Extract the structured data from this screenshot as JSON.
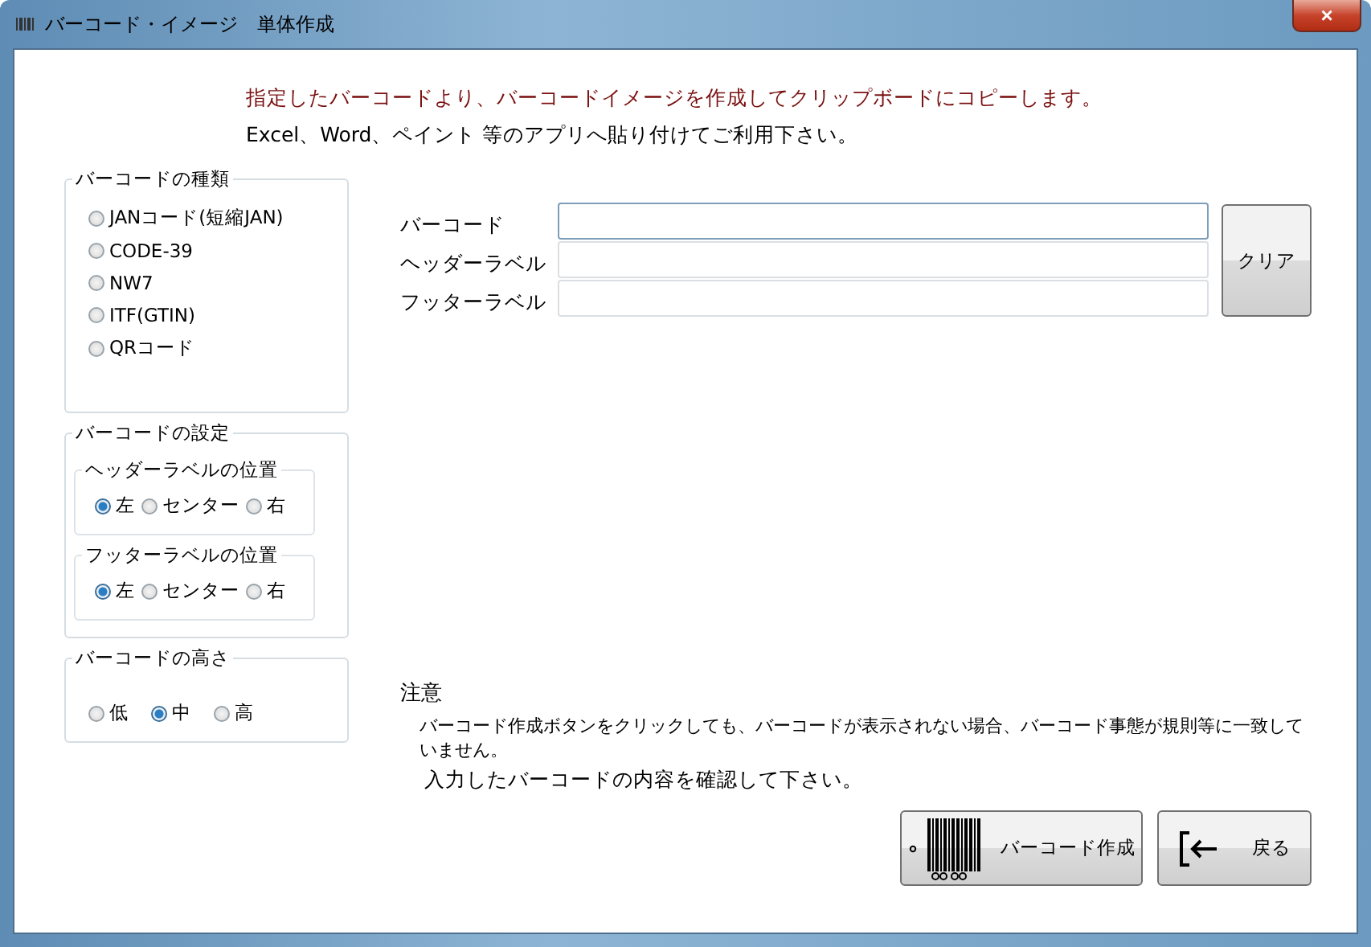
{
  "window": {
    "title": "バーコード・イメージ　単体作成",
    "close": "×"
  },
  "intro": {
    "line_1": "指定したバーコードより、バーコードイメージを作成してクリップボードにコピーします。",
    "line_2": "Excel、Word、ペイント 等のアプリへ貼り付けてご利用下さい。"
  },
  "barcode_type": {
    "title": "バーコードの種類",
    "options": [
      {
        "label": "JANコード(短縮JAN)",
        "selected": false
      },
      {
        "label": "CODE-39",
        "selected": false
      },
      {
        "label": "NW7",
        "selected": false
      },
      {
        "label": "ITF(GTIN)",
        "selected": false
      },
      {
        "label": "QRコード",
        "selected": false
      }
    ]
  },
  "barcode_settings": {
    "title": "バーコードの設定",
    "groups": [
      {
        "title": "ヘッダーラベルの位置",
        "options": [
          {
            "label": "左",
            "selected": true
          },
          {
            "label": "センター",
            "selected": false
          },
          {
            "label": "右",
            "selected": false
          }
        ]
      },
      {
        "title": "フッターラベルの位置",
        "options": [
          {
            "label": "左",
            "selected": true
          },
          {
            "label": "センター",
            "selected": false
          },
          {
            "label": "右",
            "selected": false
          }
        ]
      }
    ]
  },
  "barcode_height": {
    "title": "バーコードの高さ",
    "options": [
      {
        "label": "低",
        "selected": false
      },
      {
        "label": "中",
        "selected": true
      },
      {
        "label": "高",
        "selected": false
      }
    ]
  },
  "fields": [
    {
      "label": "バーコード",
      "focused": true
    },
    {
      "label": "ヘッダーラベル",
      "focused": false
    },
    {
      "label": "フッターラベル",
      "focused": false
    }
  ],
  "clear_button": "クリア",
  "notes": {
    "title": "注意",
    "line_1": "バーコード作成ボタンをクリックしても、バーコードが表示されない場合、バーコード事態が規則等に一致していません。",
    "line_2": "入力したバーコードの内容を確認して下さい。"
  },
  "buttons": [
    {
      "kind": "barcode",
      "label": "バーコード作成"
    },
    {
      "kind": "back",
      "label": "戻る"
    }
  ]
}
